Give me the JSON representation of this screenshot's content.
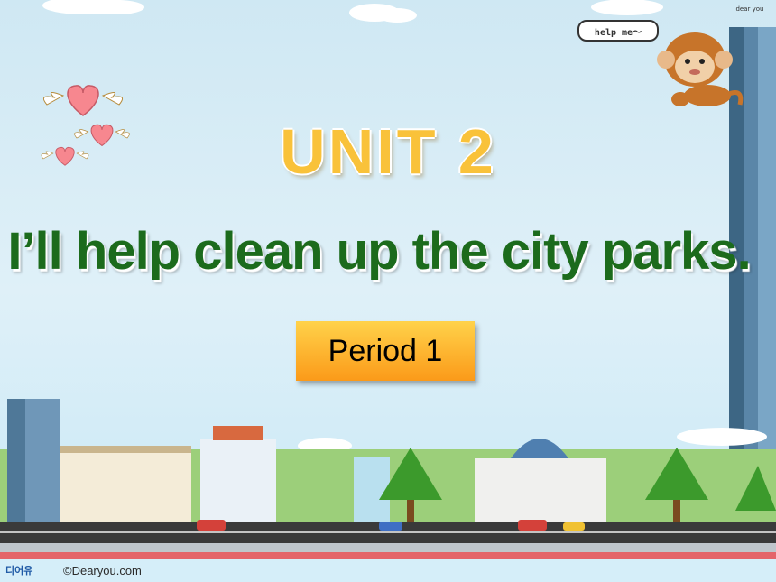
{
  "slide": {
    "unit_title": "UNIT 2",
    "lesson_title": "I’ll help clean up the city parks.",
    "period_label": "Period 1"
  },
  "mascot": {
    "speech": "help me～"
  },
  "brand": {
    "badge_text": "dear you",
    "logo_text": "디어유",
    "credit": "©Dearyou.com"
  },
  "colors": {
    "unit_title": "#f9c23a",
    "lesson_title": "#1c6b1c",
    "period_box_top": "#ffd24a",
    "period_box_bottom": "#fb9a19",
    "sky": "#d8eef8"
  }
}
